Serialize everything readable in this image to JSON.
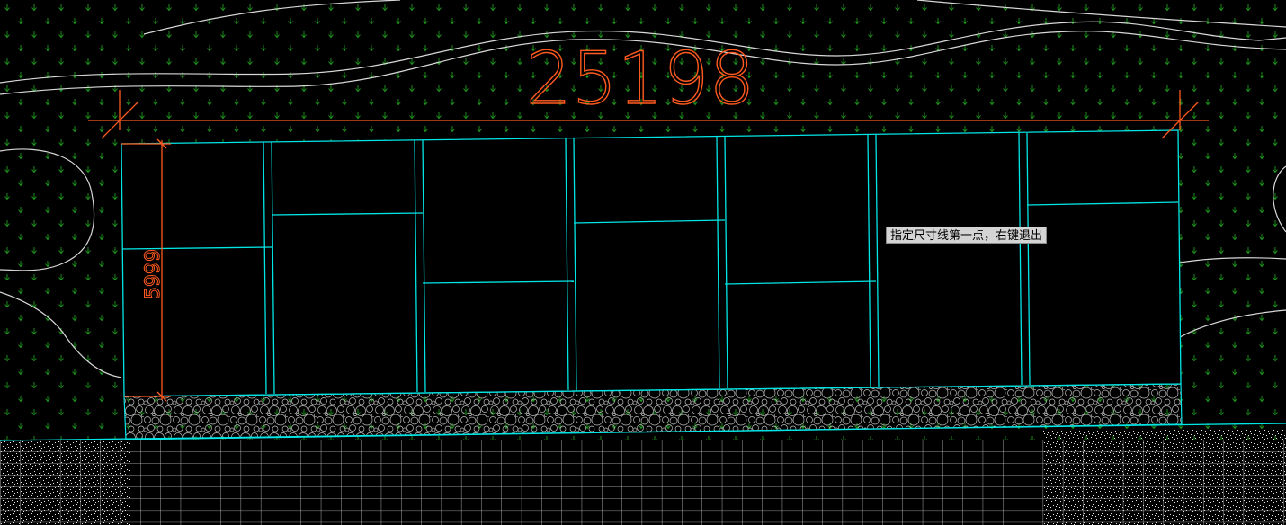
{
  "dimensions": {
    "horizontal_value": "25198",
    "vertical_value": "5999"
  },
  "prompt": {
    "text": "指定尺寸线第一点，右键退出"
  },
  "colors": {
    "background": "#000000",
    "outline": "#00e5e5",
    "dimension": "#ff5a1f",
    "grass_symbol": "#1f9a1f",
    "contour": "#d8d8d8",
    "gravel": "#bdbdbd",
    "paving_grid": "#d0d0d0"
  },
  "icons": {
    "grass_symbol": "grass-hatch-icon",
    "tick": "dimension-tick-icon"
  }
}
